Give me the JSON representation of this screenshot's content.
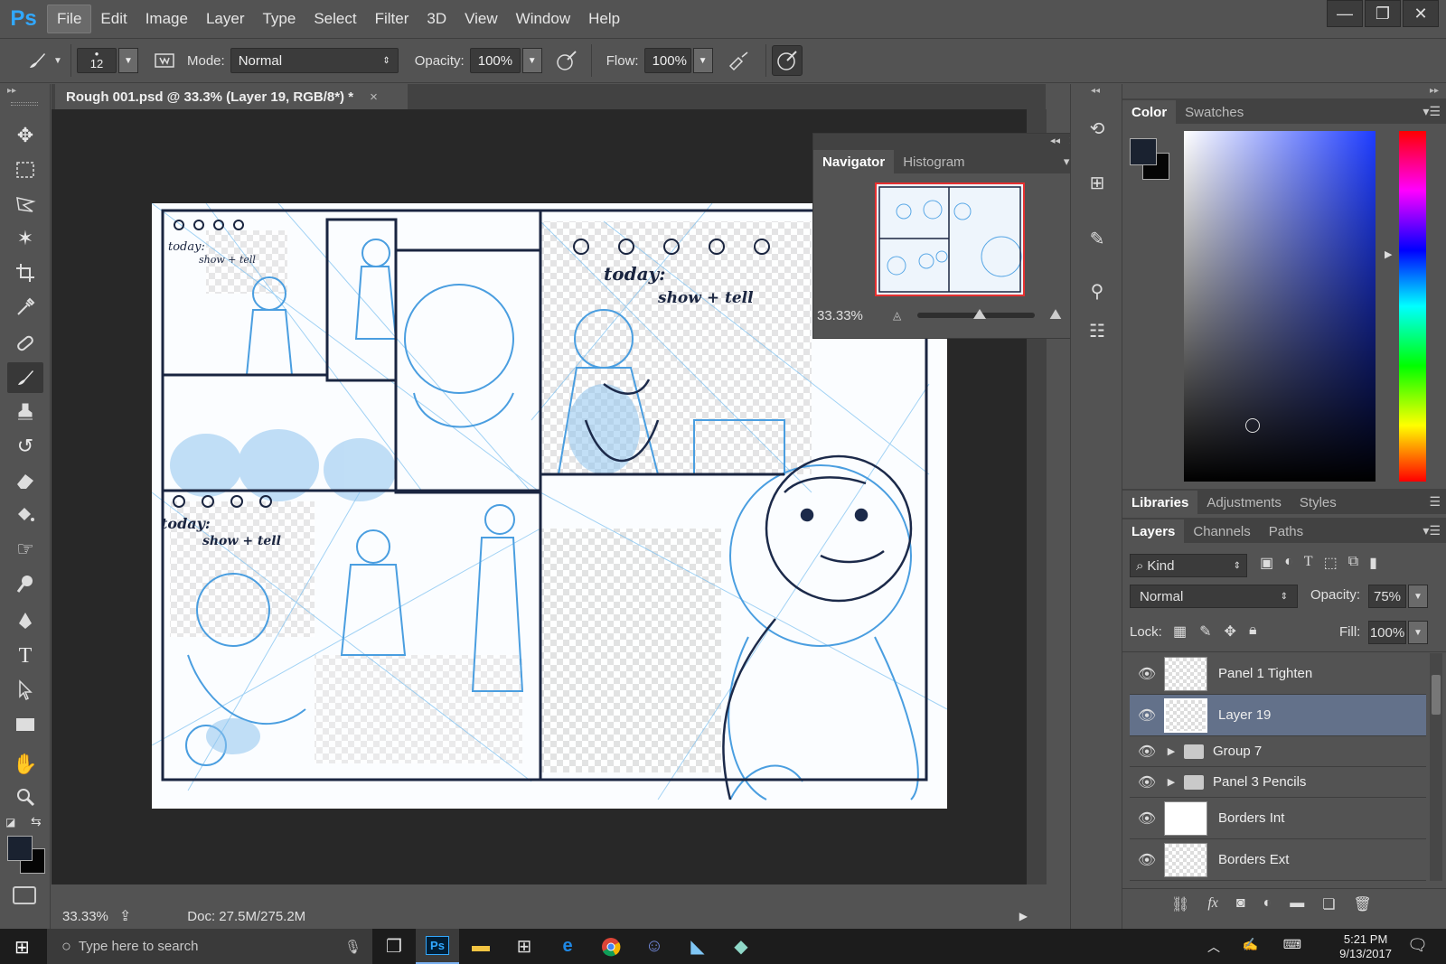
{
  "app": {
    "logo": "Ps"
  },
  "menu": [
    "File",
    "Edit",
    "Image",
    "Layer",
    "Type",
    "Select",
    "Filter",
    "3D",
    "View",
    "Window",
    "Help"
  ],
  "window_controls": {
    "minimize": "—",
    "restore": "❐",
    "close": "✕"
  },
  "options": {
    "brush_size": "12",
    "mode_label": "Mode:",
    "mode_value": "Normal",
    "opacity_label": "Opacity:",
    "opacity_value": "100%",
    "flow_label": "Flow:",
    "flow_value": "100%"
  },
  "document": {
    "tab_title": "Rough 001.psd @ 33.3% (Layer 19, RGB/8*) *",
    "close": "×",
    "zoom": "33.33%",
    "doc_size": "Doc: 27.5M/275.2M"
  },
  "artwork_text": {
    "panel1": "today:",
    "panel1b": "show + tell",
    "panel3": "today:",
    "panel3b": "show + tell",
    "panel4": "today:",
    "panel4b": "show + tell"
  },
  "navigator": {
    "tabs": [
      "Navigator",
      "Histogram"
    ],
    "active_tab": "Navigator",
    "zoom": "33.33%",
    "slider_position": 0.5
  },
  "color_panel": {
    "tabs": [
      "Color",
      "Swatches"
    ],
    "foreground": "#1a2230",
    "background": "#050505"
  },
  "libraries_tabs": [
    "Libraries",
    "Adjustments",
    "Styles"
  ],
  "layers_panel": {
    "tabs": [
      "Layers",
      "Channels",
      "Paths"
    ],
    "filter_label": "Kind",
    "blend_mode": "Normal",
    "opacity_label": "Opacity:",
    "opacity_value": "75%",
    "lock_label": "Lock:",
    "fill_label": "Fill:",
    "fill_value": "100%",
    "layers": [
      {
        "name": "Panel 1 Tighten",
        "type": "layer",
        "selected": false
      },
      {
        "name": "Layer 19",
        "type": "layer",
        "selected": true
      },
      {
        "name": "Group 7",
        "type": "group",
        "selected": false
      },
      {
        "name": "Panel 3 Pencils",
        "type": "group",
        "selected": false
      },
      {
        "name": "Borders Int",
        "type": "layer",
        "selected": false
      },
      {
        "name": "Borders Ext",
        "type": "layer",
        "selected": false
      }
    ]
  },
  "taskbar": {
    "search_placeholder": "Type here to search",
    "time": "5:21 PM",
    "date": "9/13/2017"
  },
  "colors": {
    "accent": "#31a8ff",
    "selection": "#63718a",
    "sketch_blue": "#5aa8e6",
    "ink": "#1c2a4a"
  }
}
